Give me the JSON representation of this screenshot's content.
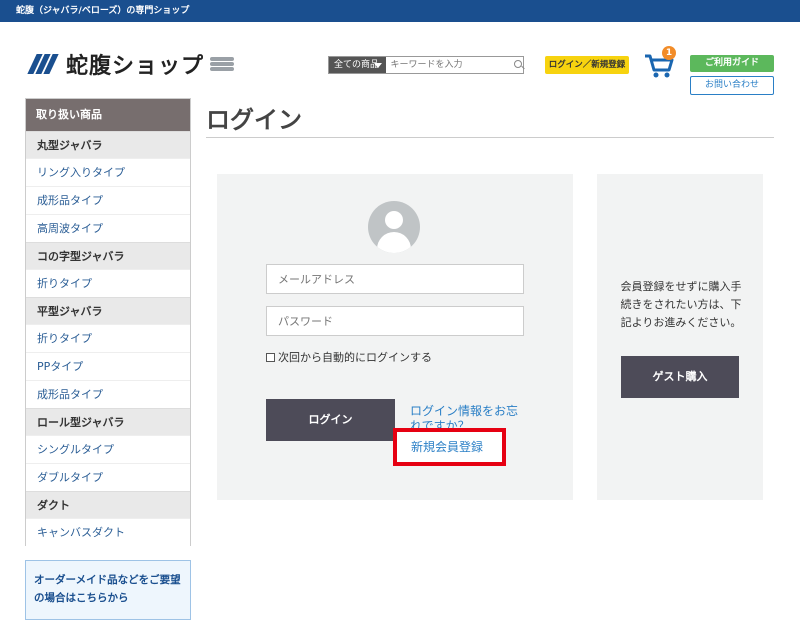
{
  "topbar": {
    "text": "蛇腹（ジャバラ/ベローズ）の専門ショップ"
  },
  "header": {
    "logo_text": "蛇腹ショップ",
    "search": {
      "category": "全ての商品",
      "placeholder": "キーワードを入力"
    },
    "login_register": "ログイン／新規登録",
    "cart_count": "1",
    "guide": "ご利用ガイド",
    "contact": "お問い合わせ"
  },
  "sidebar": {
    "title": "取り扱い商品",
    "groups": [
      {
        "category": "丸型ジャバラ",
        "items": [
          "リング入りタイプ",
          "成形品タイプ",
          "高周波タイプ"
        ]
      },
      {
        "category": "コの字型ジャバラ",
        "items": [
          "折りタイプ"
        ]
      },
      {
        "category": "平型ジャバラ",
        "items": [
          "折りタイプ",
          "PPタイプ",
          "成形品タイプ"
        ]
      },
      {
        "category": "ロール型ジャバラ",
        "items": [
          "シングルタイプ",
          "ダブルタイプ"
        ]
      },
      {
        "category": "ダクト",
        "items": [
          "キャンバスダクト"
        ]
      }
    ],
    "order_box": "オーダーメイド品などをご要望の場合はこちらから"
  },
  "main": {
    "title": "ログイン",
    "login": {
      "email_placeholder": "メールアドレス",
      "password_placeholder": "パスワード",
      "remember": "次回から自動的にログインする",
      "submit": "ログイン",
      "forgot": "ログイン情報をお忘れですか？",
      "register": "新規会員登録"
    },
    "guest": {
      "text": "会員登録をせずに購入手続きをされたい方は、下記よりお進みください。",
      "button": "ゲスト購入"
    }
  },
  "colors": {
    "brand": "#1a4f8f",
    "highlight": "#e60012",
    "button": "#4d4b58"
  }
}
